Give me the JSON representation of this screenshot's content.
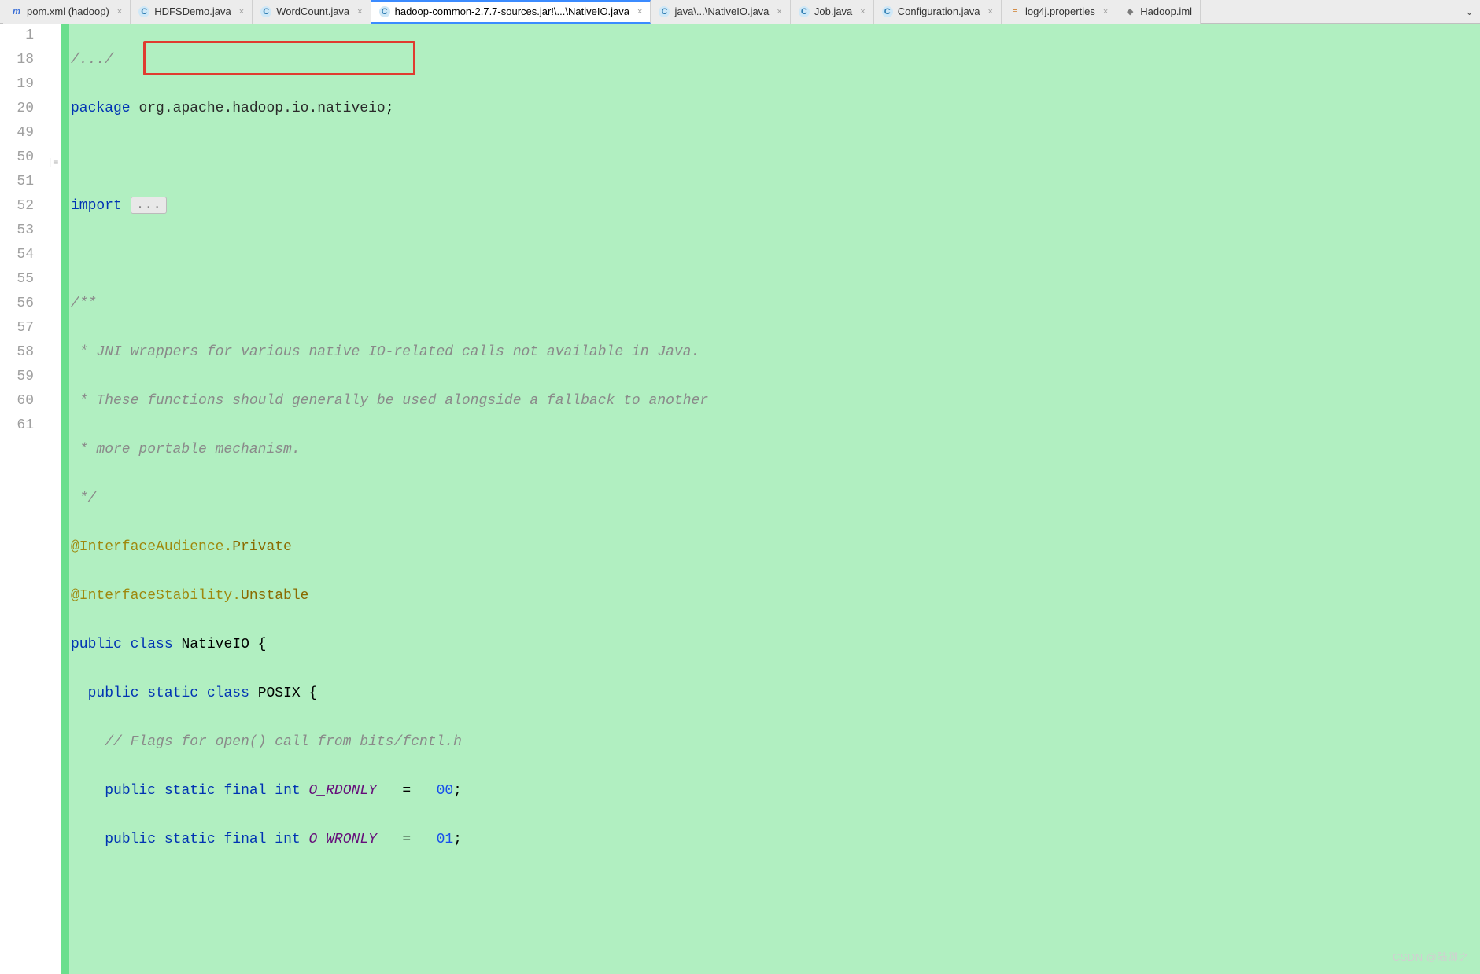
{
  "tabs": [
    {
      "label": "pom.xml (hadoop)",
      "icon": "m",
      "iconColor": "#3b6fd6",
      "active": false
    },
    {
      "label": "HDFSDemo.java",
      "icon": "C",
      "iconColor": "#4aa0d9",
      "active": false
    },
    {
      "label": "WordCount.java",
      "icon": "C",
      "iconColor": "#4aa0d9",
      "active": false
    },
    {
      "label": "hadoop-common-2.7.7-sources.jar!\\...\\NativeIO.java",
      "icon": "C",
      "iconColor": "#4aa0d9",
      "active": true
    },
    {
      "label": "java\\...\\NativeIO.java",
      "icon": "C",
      "iconColor": "#4aa0d9",
      "active": false
    },
    {
      "label": "Job.java",
      "icon": "C",
      "iconColor": "#4aa0d9",
      "active": false
    },
    {
      "label": "Configuration.java",
      "icon": "C",
      "iconColor": "#4aa0d9",
      "active": false
    },
    {
      "label": "log4j.properties",
      "icon": "≡",
      "iconColor": "#d08030",
      "active": false
    },
    {
      "label": "Hadoop.iml",
      "icon": "◆",
      "iconColor": "#7a7a7a",
      "active": false
    }
  ],
  "gutter": [
    "1",
    "18",
    "19",
    "20",
    "49",
    "50",
    "51",
    "52",
    "53",
    "54",
    "55",
    "56",
    "57",
    "58",
    "59",
    "60",
    "61"
  ],
  "code": {
    "l1_fold": "/.../",
    "pkg_kw": "package",
    "pkg_name": "org.apache.hadoop.io.nativeio",
    "semi1": ";",
    "import_kw": "import",
    "import_fold": "...",
    "doc_open": "/**",
    "doc_l1": " * JNI wrappers for various native IO-related calls not available in Java.",
    "doc_l2": " * These functions should generally be used alongside a fallback to another",
    "doc_l3": " * more portable mechanism.",
    "doc_close": " */",
    "ann1_at": "@InterfaceAudience",
    "ann1_dot": ".",
    "ann1_val": "Private",
    "ann2_at": "@InterfaceStability",
    "ann2_dot": ".",
    "ann2_val": "Unstable",
    "pub": "public",
    "cls_kw": "class",
    "cls_name": "NativeIO",
    "brace_o": " {",
    "static_kw": "static",
    "posix": "POSIX",
    "flags_comment": "// Flags for open() call from bits/fcntl.h",
    "final_kw": "final",
    "int_kw": "int",
    "o_rdonly": "O_RDONLY",
    "eq": "=",
    "val00": "00",
    "o_wronly": "O_WRONLY",
    "val01": "01",
    "semi": ";"
  },
  "watermark": "CSDN @陆卿之"
}
